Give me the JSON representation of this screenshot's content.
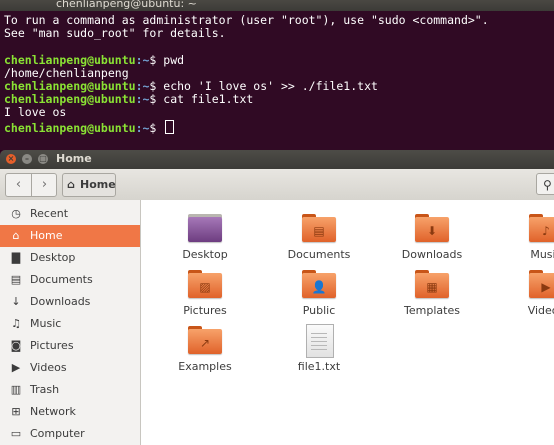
{
  "terminal": {
    "title": "chenlianpeng@ubuntu: ~",
    "lines": [
      {
        "type": "text",
        "text": "To run a command as administrator (user \"root\"), use \"sudo <command>\"."
      },
      {
        "type": "text",
        "text": "See \"man sudo_root\" for details."
      },
      {
        "type": "text",
        "text": ""
      },
      {
        "type": "prompt",
        "user": "chenlianpeng@ubuntu",
        "path": ":~",
        "sign": "$ ",
        "cmd": "pwd"
      },
      {
        "type": "text",
        "text": "/home/chenlianpeng"
      },
      {
        "type": "prompt",
        "user": "chenlianpeng@ubuntu",
        "path": ":~",
        "sign": "$ ",
        "cmd": "echo 'I love os' >> ./file1.txt"
      },
      {
        "type": "prompt",
        "user": "chenlianpeng@ubuntu",
        "path": ":~",
        "sign": "$ ",
        "cmd": "cat file1.txt"
      },
      {
        "type": "text",
        "text": "I love os"
      },
      {
        "type": "prompt",
        "user": "chenlianpeng@ubuntu",
        "path": ":~",
        "sign": "$ ",
        "cmd": ""
      }
    ]
  },
  "files_window": {
    "title": "Home",
    "window_buttons": {
      "close": "×",
      "minimize": "–",
      "maximize": "□"
    },
    "toolbar": {
      "back_icon": "‹",
      "forward_icon": "›",
      "breadcrumb_label": "Home",
      "breadcrumb_icon": "⌂",
      "search_icon": "⚲"
    },
    "sidebar": [
      {
        "label": "Recent",
        "icon": "◷",
        "icon_name": "recent-icon"
      },
      {
        "label": "Home",
        "icon": "⌂",
        "icon_name": "home-icon",
        "active": true
      },
      {
        "label": "Desktop",
        "icon": "▇",
        "icon_name": "desktop-icon"
      },
      {
        "label": "Documents",
        "icon": "▤",
        "icon_name": "documents-icon"
      },
      {
        "label": "Downloads",
        "icon": "↓",
        "icon_name": "downloads-icon"
      },
      {
        "label": "Music",
        "icon": "♫",
        "icon_name": "music-icon"
      },
      {
        "label": "Pictures",
        "icon": "◙",
        "icon_name": "pictures-icon"
      },
      {
        "label": "Videos",
        "icon": "▶",
        "icon_name": "videos-icon"
      },
      {
        "label": "Trash",
        "icon": "▥",
        "icon_name": "trash-icon"
      },
      {
        "label": "Network",
        "icon": "⊞",
        "icon_name": "network-icon"
      },
      {
        "label": "Computer",
        "icon": "▭",
        "icon_name": "computer-icon"
      }
    ],
    "files": [
      {
        "label": "Desktop",
        "kind": "desktop",
        "emblem": ""
      },
      {
        "label": "Documents",
        "kind": "folder",
        "emblem": "▤"
      },
      {
        "label": "Downloads",
        "kind": "folder",
        "emblem": "⬇"
      },
      {
        "label": "Music",
        "kind": "folder",
        "emblem": "♪"
      },
      {
        "label": "Pictures",
        "kind": "folder",
        "emblem": "▨"
      },
      {
        "label": "Public",
        "kind": "folder",
        "emblem": "👤"
      },
      {
        "label": "Templates",
        "kind": "folder",
        "emblem": "▦"
      },
      {
        "label": "Videos",
        "kind": "folder",
        "emblem": "▶"
      },
      {
        "label": "Examples",
        "kind": "folder",
        "emblem": "↗"
      },
      {
        "label": "file1.txt",
        "kind": "text",
        "emblem": ""
      }
    ]
  }
}
